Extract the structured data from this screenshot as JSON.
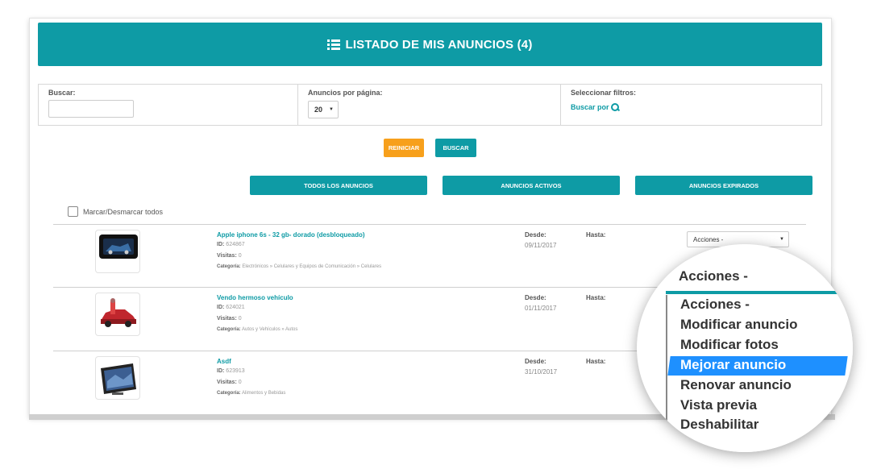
{
  "header": {
    "title": "LISTADO DE MIS ANUNCIOS (4)"
  },
  "filters": {
    "search_label": "Buscar:",
    "search_value": "",
    "per_page_label": "Anuncios por página:",
    "per_page_value": "20",
    "select_filters_label": "Seleccionar filtros:",
    "search_by_link": "Buscar por"
  },
  "buttons": {
    "reset": "REINICIAR",
    "search": "BUSCAR"
  },
  "tabs": [
    {
      "label": "TODOS LOS ANUNCIOS"
    },
    {
      "label": "ANUNCIOS ACTIVOS"
    },
    {
      "label": "ANUNCIOS EXPIRADOS"
    }
  ],
  "mark_all_label": "Marcar/Desmarcar todos",
  "listing_labels": {
    "id": "ID:",
    "visits": "Visitas:",
    "category": "Categoría:",
    "from": "Desde:",
    "to": "Hasta:"
  },
  "listings": [
    {
      "title": "Apple iphone 6s - 32 gb- dorado (desbloqueado)",
      "id": "624867",
      "visits": "0",
      "category": "Electrónicos » Celulares y Equipos de Comunicación » Celulares",
      "from": "09/11/2017",
      "actions": "Acciones -"
    },
    {
      "title": "Vendo hermoso vehículo",
      "id": "624021",
      "visits": "0",
      "category": "Autos y Vehículos » Autos",
      "from": "01/11/2017"
    },
    {
      "title": "Asdf",
      "id": "623913",
      "visits": "0",
      "category": "Alimentos y Bebidas",
      "from": "31/10/2017"
    }
  ],
  "zoom_dropdown": {
    "selected": "Acciones -",
    "options": [
      "Acciones -",
      "Modificar anuncio",
      "Modificar fotos",
      "Mejorar anuncio",
      "Renovar anuncio",
      "Vista previa",
      "Deshabilitar"
    ],
    "highlighted": "Mejorar anuncio"
  },
  "colors": {
    "primary": "#0e9ba5",
    "reset": "#f7a01c",
    "highlight": "#1e90ff"
  }
}
